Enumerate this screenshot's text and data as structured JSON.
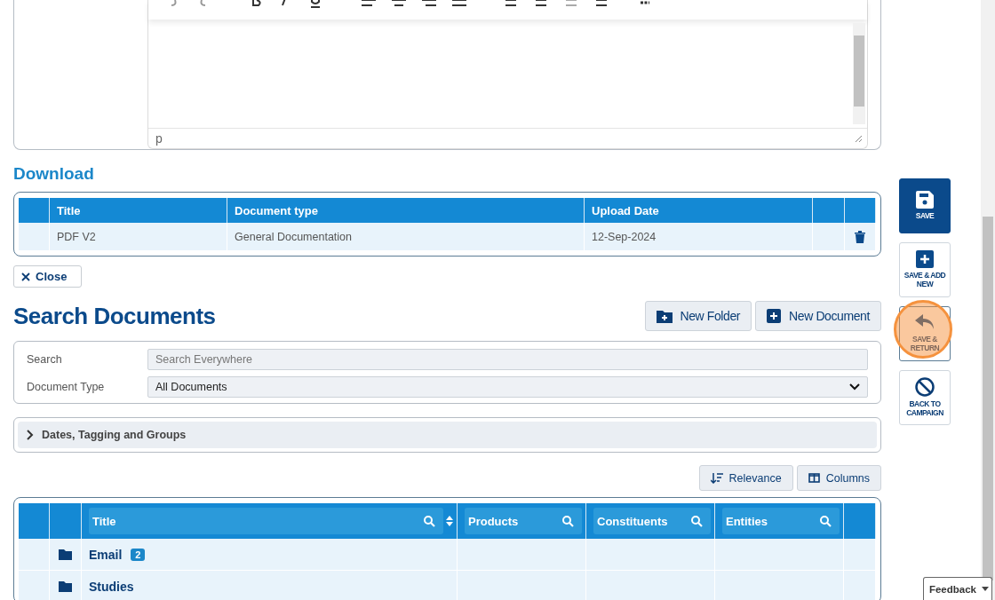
{
  "editor": {
    "status": "p"
  },
  "download": {
    "heading": "Download",
    "columns": [
      "Title",
      "Document type",
      "Upload Date"
    ],
    "rows": [
      {
        "title": "PDF V2",
        "type": "General Documentation",
        "date": "12-Sep-2024"
      }
    ],
    "close": "Close"
  },
  "search": {
    "heading": "Search Documents",
    "buttons": [
      {
        "label": "New Folder",
        "kind": "folder"
      },
      {
        "label": "New Document",
        "kind": "document"
      }
    ],
    "fields": [
      {
        "label": "Search",
        "kind": "text",
        "placeholder": "Search Everywhere"
      },
      {
        "label": "Document Type",
        "kind": "select",
        "value": "All Documents"
      }
    ],
    "filters": {
      "label": "Dates, Tagging and Groups",
      "expanded": false
    },
    "sort": "Relevance",
    "columns_button": "Columns"
  },
  "results": {
    "columns": [
      {
        "label": "Title",
        "sortable": true
      },
      {
        "label": "Products",
        "sortable": false
      },
      {
        "label": "Constituents",
        "sortable": false
      },
      {
        "label": "Entities",
        "sortable": false
      }
    ],
    "rows": [
      {
        "title": "Email",
        "count": "2"
      },
      {
        "title": "Studies"
      }
    ]
  },
  "actions": [
    {
      "label": "SAVE",
      "kind": "save",
      "primary": true,
      "highlighted": false
    },
    {
      "label": "SAVE & ADD NEW",
      "kind": "add",
      "primary": false,
      "highlighted": false
    },
    {
      "label": "SAVE & RETURN",
      "kind": "return",
      "primary": false,
      "highlighted": true
    },
    {
      "label": "BACK TO CAMPAIGN",
      "kind": "back",
      "primary": false,
      "highlighted": false
    }
  ],
  "feedback": "Feedback"
}
